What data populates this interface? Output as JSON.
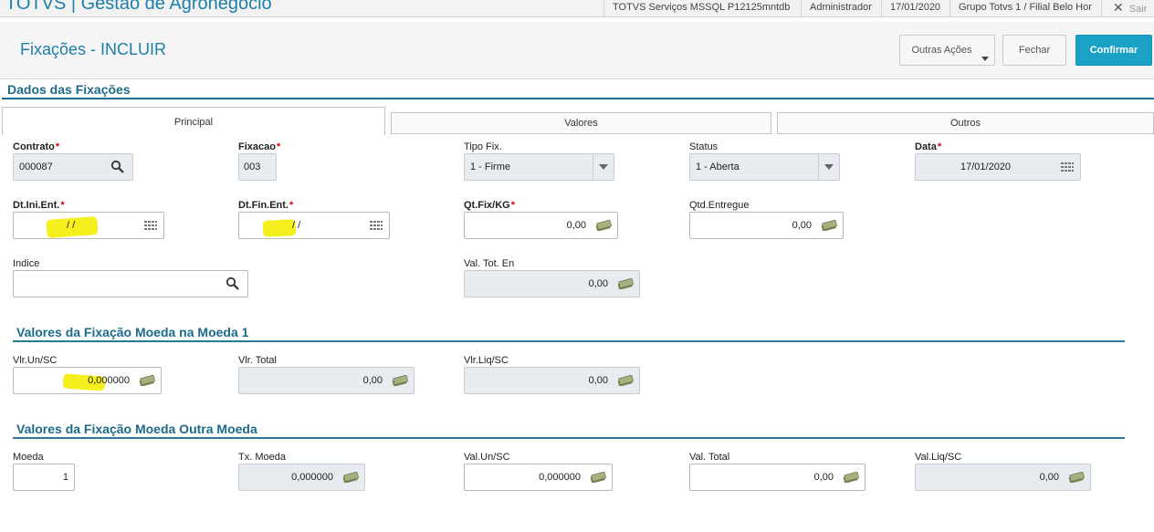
{
  "topbar": {
    "app_title": "TOTVS | Gestão de Agronegócio",
    "server": "TOTVS Serviços MSSQL P12125mntdb",
    "user": "Administrador",
    "date": "17/01/2020",
    "branch": "Grupo Totvs 1 / Filial Belo Hor",
    "exit_label": "Sair"
  },
  "header": {
    "title": "Fixações - INCLUIR",
    "more_actions_label": "Outras Ações",
    "close_label": "Fechar",
    "confirm_label": "Confirmar"
  },
  "section_title": "Dados das Fixações",
  "tabs": {
    "principal": "Principal",
    "valores": "Valores",
    "outros": "Outros"
  },
  "fields": {
    "contrato": {
      "label": "Contrato",
      "value": "000087"
    },
    "fixacao": {
      "label": "Fixacao",
      "value": "003"
    },
    "tipo_fix": {
      "label": "Tipo Fix.",
      "value": "1 - Firme"
    },
    "status": {
      "label": "Status",
      "value": "1 - Aberta"
    },
    "data": {
      "label": "Data",
      "value": "17/01/2020"
    },
    "dt_ini": {
      "label": "Dt.Ini.Ent.",
      "value": "/  /"
    },
    "dt_fin": {
      "label": "Dt.Fin.Ent.",
      "value": "/  /"
    },
    "qt_fix": {
      "label": "Qt.Fix/KG",
      "value": "0,00"
    },
    "qtd_entregue": {
      "label": "Qtd.Entregue",
      "value": "0,00"
    },
    "indice": {
      "label": "Indice",
      "value": ""
    },
    "val_tot_en": {
      "label": "Val. Tot. En",
      "value": "0,00"
    }
  },
  "moeda1": {
    "title": "Valores da Fixação Moeda na Moeda 1",
    "vlr_un": {
      "label": "Vlr.Un/SC",
      "value": "0,000000"
    },
    "vlr_total": {
      "label": "Vlr. Total",
      "value": "0,00"
    },
    "vlr_liq": {
      "label": "Vlr.Liq/SC",
      "value": "0,00"
    }
  },
  "outra": {
    "title": "Valores da Fixação Moeda Outra Moeda",
    "moeda": {
      "label": "Moeda",
      "value": "1"
    },
    "tx_moeda": {
      "label": "Tx. Moeda",
      "value": "0,000000"
    },
    "val_un": {
      "label": "Val.Un/SC",
      "value": "0,000000"
    },
    "val_total": {
      "label": "Val. Total",
      "value": "0,00"
    },
    "val_liq": {
      "label": "Val.Liq/SC",
      "value": "0,00"
    }
  },
  "colors": {
    "accent": "#1aa1c6",
    "title_blue": "#1e7fa8",
    "highlight": "#f5f01d",
    "required": "#d0021b"
  }
}
